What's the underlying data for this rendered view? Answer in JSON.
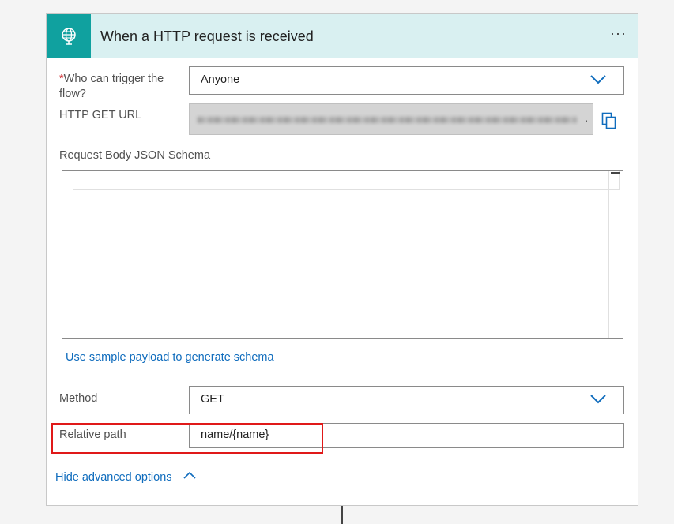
{
  "header": {
    "title": "When a HTTP request is received",
    "menu_label": "···",
    "icon": "globe-request-icon",
    "accent_color": "#10a19f",
    "background_color": "#d9f0f1"
  },
  "who_can_trigger": {
    "required_marker": "*",
    "label": "Who can trigger the flow?",
    "value": "Anyone"
  },
  "http_get_url": {
    "label": "HTTP GET URL",
    "value_suffix": "."
  },
  "schema": {
    "label": "Request Body JSON Schema",
    "value": ""
  },
  "sample_payload_link": "Use sample payload to generate schema",
  "method": {
    "label": "Method",
    "value": "GET"
  },
  "relative_path": {
    "label": "Relative path",
    "value": "name/{name}",
    "highlight_color": "#e01919"
  },
  "advanced_toggle": "Hide advanced options"
}
